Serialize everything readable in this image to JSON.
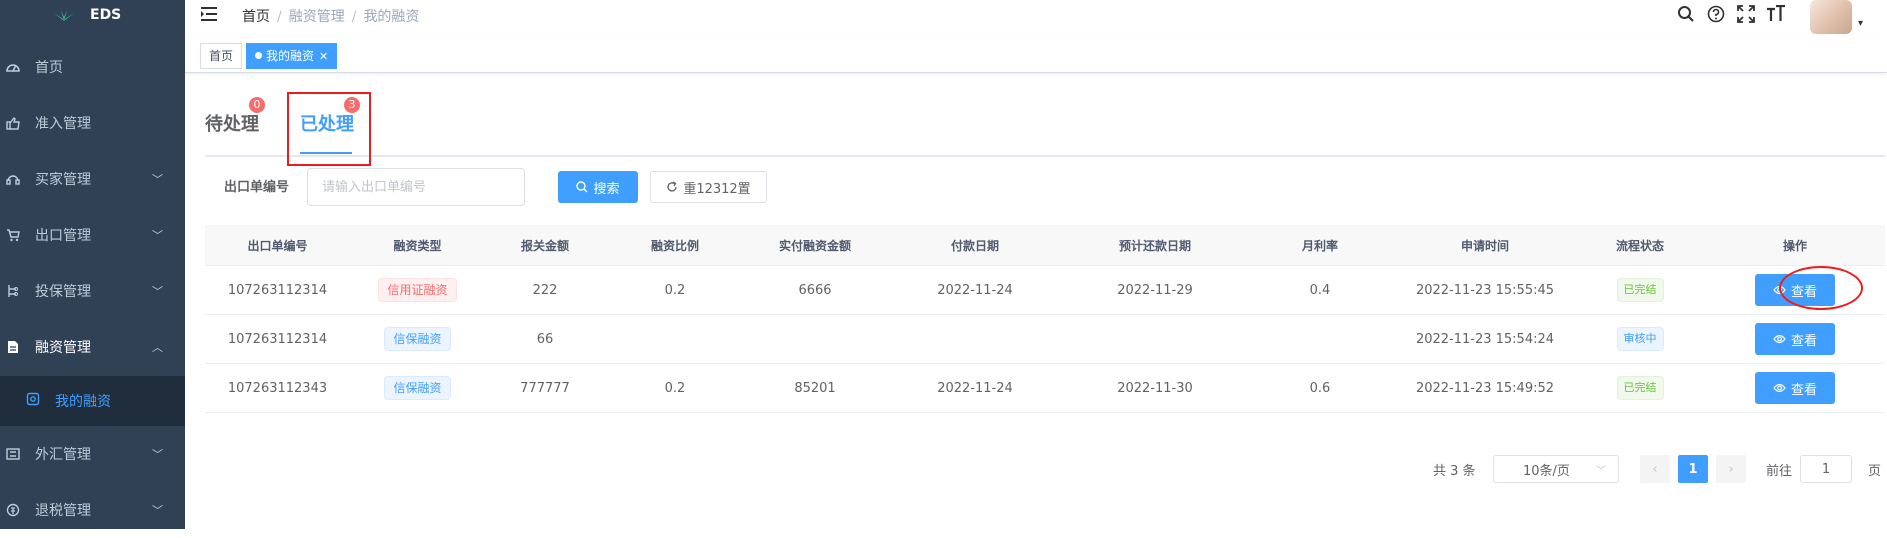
{
  "app": {
    "name": "EDS"
  },
  "sidebar": {
    "items": [
      {
        "label": "首页",
        "icon": "dashboard-icon",
        "has_children": false
      },
      {
        "label": "准入管理",
        "icon": "hand-icon",
        "has_children": false
      },
      {
        "label": "买家管理",
        "icon": "headset-icon",
        "has_children": true
      },
      {
        "label": "出口管理",
        "icon": "cart-icon",
        "has_children": true
      },
      {
        "label": "投保管理",
        "icon": "sliders-icon",
        "has_children": true
      },
      {
        "label": "融资管理",
        "icon": "document-icon",
        "has_children": true,
        "open": true
      },
      {
        "label": "外汇管理",
        "icon": "exchange-icon",
        "has_children": true
      },
      {
        "label": "退税管理",
        "icon": "refund-icon",
        "has_children": true
      }
    ],
    "submenu": {
      "label": "我的融资",
      "icon": "target-icon"
    }
  },
  "header": {
    "breadcrumb": [
      "首页",
      "融资管理",
      "我的融资"
    ],
    "icons": [
      "search-icon",
      "help-icon",
      "fullscreen-icon",
      "font-size-icon"
    ]
  },
  "tags_view": {
    "tags": [
      {
        "label": "首页",
        "active": false
      },
      {
        "label": "我的融资",
        "active": true
      }
    ]
  },
  "tabs": [
    {
      "label": "待处理",
      "badge": "0",
      "active": false
    },
    {
      "label": "已处理",
      "badge": "3",
      "active": true
    }
  ],
  "search": {
    "label": "出口单编号",
    "placeholder": "请输入出口单编号",
    "value": "",
    "search_button": "搜索",
    "reset_button": "重12312置"
  },
  "table": {
    "columns": [
      "出口单编号",
      "融资类型",
      "报关金额",
      "融资比例",
      "实付融资金额",
      "付款日期",
      "预计还款日期",
      "月利率",
      "申请时间",
      "流程状态",
      "操作"
    ],
    "rows": [
      {
        "id": "107263112314",
        "type": "信用证融资",
        "type_style": "danger",
        "customs_amount": "222",
        "ratio": "0.2",
        "paid_amount": "6666",
        "pay_date": "2022-11-24",
        "repay_date": "2022-11-29",
        "monthly_rate": "0.4",
        "apply_time": "2022-11-23 15:55:45",
        "status": "已完结",
        "status_style": "success",
        "action": "查看"
      },
      {
        "id": "107263112314",
        "type": "信保融资",
        "type_style": "primary",
        "customs_amount": "66",
        "ratio": "",
        "paid_amount": "",
        "pay_date": "",
        "repay_date": "",
        "monthly_rate": "",
        "apply_time": "2022-11-23 15:54:24",
        "status": "审核中",
        "status_style": "info",
        "action": "查看"
      },
      {
        "id": "107263112343",
        "type": "信保融资",
        "type_style": "primary",
        "customs_amount": "777777",
        "ratio": "0.2",
        "paid_amount": "85201",
        "pay_date": "2022-11-24",
        "repay_date": "2022-11-30",
        "monthly_rate": "0.6",
        "apply_time": "2022-11-23 15:49:52",
        "status": "已完结",
        "status_style": "success",
        "action": "查看"
      }
    ]
  },
  "pagination": {
    "total_text": "共 3 条",
    "page_size": "10条/页",
    "current_page": "1",
    "goto_label": "前往",
    "goto_value": "1",
    "page_suffix": "页"
  },
  "colors": {
    "primary": "#409eff",
    "sidebar_bg": "#304156",
    "danger": "#f56c6c",
    "success": "#67c23a",
    "annotation": "#ee1c1c"
  }
}
